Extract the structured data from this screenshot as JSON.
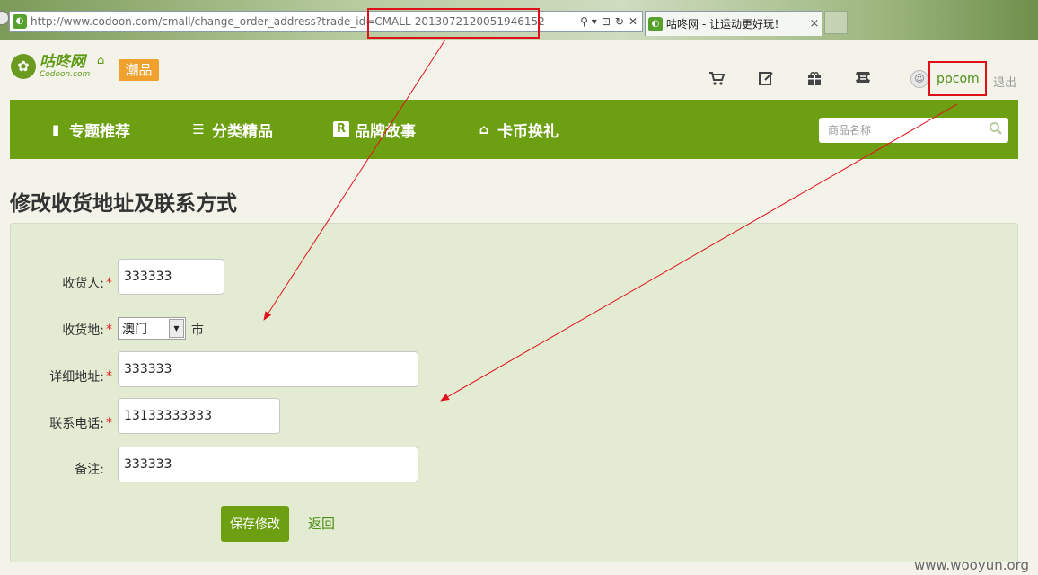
{
  "browser": {
    "url": "http://www.codoon.com/cmall/change_order_address?trade_id=CMALL-2013072120051946152",
    "tab_title": "咕咚网 - 让运动更好玩！",
    "tab_close": "×",
    "addr_buttons": [
      "⚲ ▾",
      "⊡",
      "↻",
      "✕"
    ]
  },
  "header": {
    "logo_text": "咕咚网",
    "logo_sub": "Codoon.com",
    "badge": "潮品",
    "username": "ppcom",
    "logout": "退出",
    "icons": [
      "cart-icon",
      "edit-icon",
      "gift-icon",
      "coupon-icon",
      "avatar-icon"
    ]
  },
  "nav": {
    "items": [
      {
        "label": "专题推荐",
        "icon": "topic-icon",
        "glyph": "▮"
      },
      {
        "label": "分类精品",
        "icon": "list-icon",
        "glyph": "☰"
      },
      {
        "label": "品牌故事",
        "icon": "brand-icon",
        "glyph": "R"
      },
      {
        "label": "卡币换礼",
        "icon": "gift-box-icon",
        "glyph": "⌂"
      }
    ],
    "search_placeholder": "商品名称"
  },
  "page": {
    "title": "修改收货地址及联系方式"
  },
  "form": {
    "consignee_label": "收货人:",
    "consignee_value": "333333",
    "region_label": "收货地:",
    "region_value": "澳门",
    "region_suffix": "市",
    "address_label": "详细地址:",
    "address_value": "333333",
    "phone_label": "联系电话:",
    "phone_value": "13133333333",
    "note_label": "备注:",
    "note_value": "333333",
    "required_mark": "*",
    "save_label": "保存修改",
    "back_label": "返回"
  },
  "watermark": "www.wooyun.org",
  "colors": {
    "brand_green": "#6d9f12",
    "annotation_red": "#e0101a",
    "badge_orange": "#f0a02c"
  }
}
